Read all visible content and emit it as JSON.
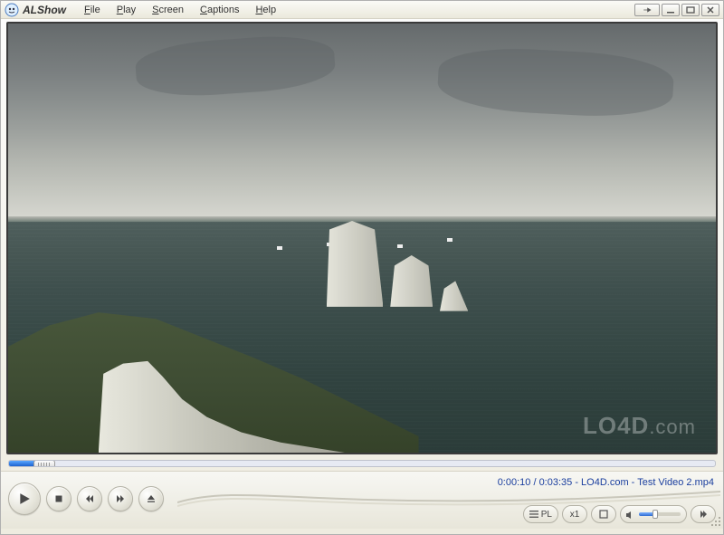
{
  "app": {
    "title": "ALShow"
  },
  "menubar": {
    "items": [
      {
        "hotkey": "F",
        "rest": "ile"
      },
      {
        "hotkey": "P",
        "rest": "lay"
      },
      {
        "hotkey": "S",
        "rest": "creen"
      },
      {
        "hotkey": "C",
        "rest": "aptions"
      },
      {
        "hotkey": "H",
        "rest": "elp"
      }
    ]
  },
  "playback": {
    "position": "0:00:10",
    "duration": "0:03:35",
    "source": "LO4D.com",
    "filename": "Test Video 2.mp4",
    "progress_percent": 5,
    "volume_percent": 40
  },
  "right_panel": {
    "playlist_label": "PL",
    "zoom_label": "x1"
  },
  "watermark": {
    "brand": "LO4D",
    "domain": ".com"
  },
  "icons": {
    "pin": "pin-icon",
    "minimize": "minimize-icon",
    "maximize": "maximize-icon",
    "close": "close-icon",
    "play": "play-icon",
    "stop": "stop-icon",
    "prev": "prev-icon",
    "next": "next-icon",
    "eject": "eject-icon",
    "playlist": "playlist-icon",
    "speaker": "speaker-icon",
    "expand": "expand-icon",
    "list": "list-icon"
  }
}
